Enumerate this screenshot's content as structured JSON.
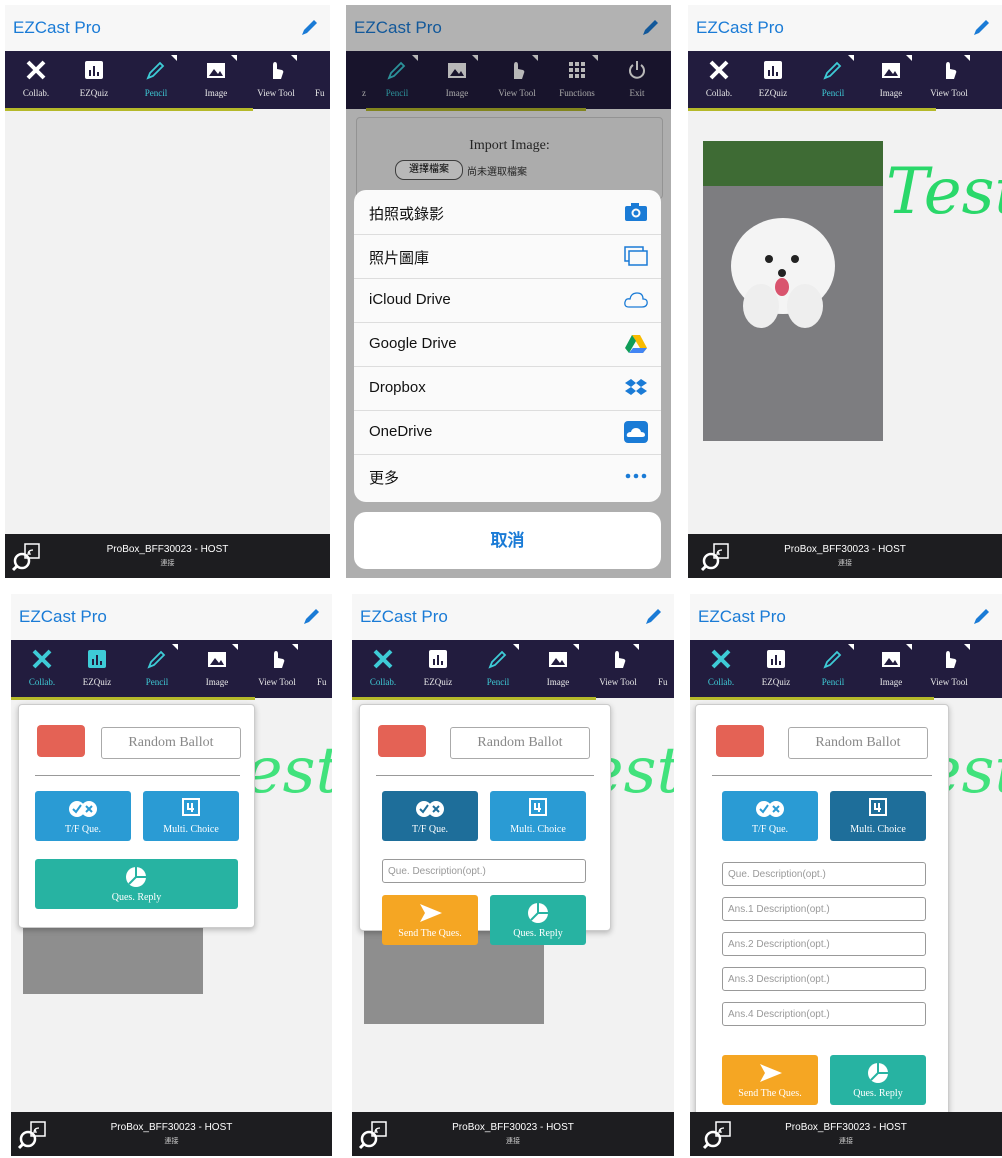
{
  "app": {
    "title": "EZCast Pro"
  },
  "toolbar": {
    "collab": "Collab.",
    "ezquiz": "EZQuiz",
    "pencil": "Pencil",
    "image": "Image",
    "view_tool": "View Tool",
    "functions": "Functions",
    "exit": "Exit",
    "fu_partial": "Fu",
    "z_partial": "z"
  },
  "bottom": {
    "device": "ProBox_BFF30023 - HOST",
    "status": "連接"
  },
  "import": {
    "title": "Import Image:",
    "choose_file": "選擇檔案",
    "no_file": "尚未選取檔案"
  },
  "sheet": {
    "items": [
      "拍照或錄影",
      "照片圖庫",
      "iCloud Drive",
      "Google Drive",
      "Dropbox",
      "OneDrive",
      "更多"
    ],
    "cancel": "取消"
  },
  "canvas": {
    "drawn_text": "Test"
  },
  "quiz": {
    "random_ballot": "Random Ballot",
    "tf": "T/F Que.",
    "multi": "Multi. Choice",
    "reply": "Ques. Reply",
    "send": "Send The Ques.",
    "que_placeholder": "Que. Description(opt.)",
    "ans_placeholders": [
      "Ans.1 Description(opt.)",
      "Ans.2 Description(opt.)",
      "Ans.3 Description(opt.)",
      "Ans.4 Description(opt.)"
    ]
  },
  "colors": {
    "accent": "#1a7bd6",
    "toolbar": "#221c3e",
    "active": "#3ecbd6",
    "ballot": "#e46255",
    "blue": "#2a9bd4",
    "teal": "#27b3a2",
    "orange": "#f5a623",
    "ink": "#2ad86a"
  }
}
